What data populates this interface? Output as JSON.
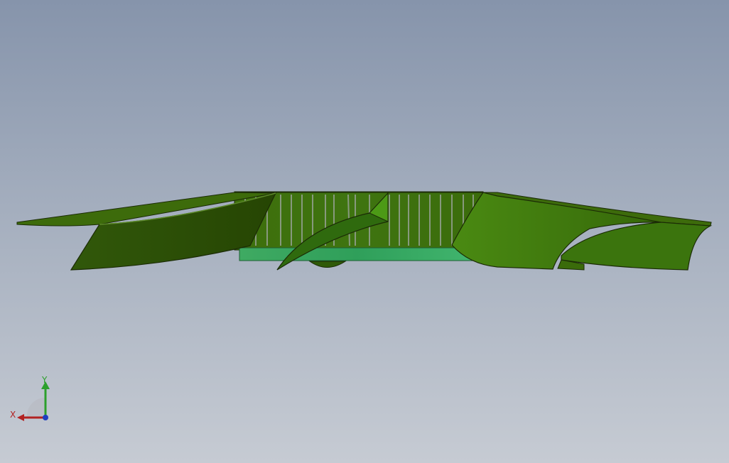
{
  "viewport": {
    "background_top": "#8694ab",
    "background_bottom": "#c6cbd3"
  },
  "model": {
    "name": "impeller-fan",
    "colors": {
      "blade_dark": "#2c4f04",
      "blade_mid": "#3a6b0a",
      "blade_light": "#4d8a14",
      "hub": "#3fb36b",
      "edge": "#1b2b06"
    }
  },
  "triad": {
    "x_label": "X",
    "y_label": "Y",
    "x_color": "#b22222",
    "y_color": "#2ca02c",
    "z_color": "#1f3fbf"
  }
}
